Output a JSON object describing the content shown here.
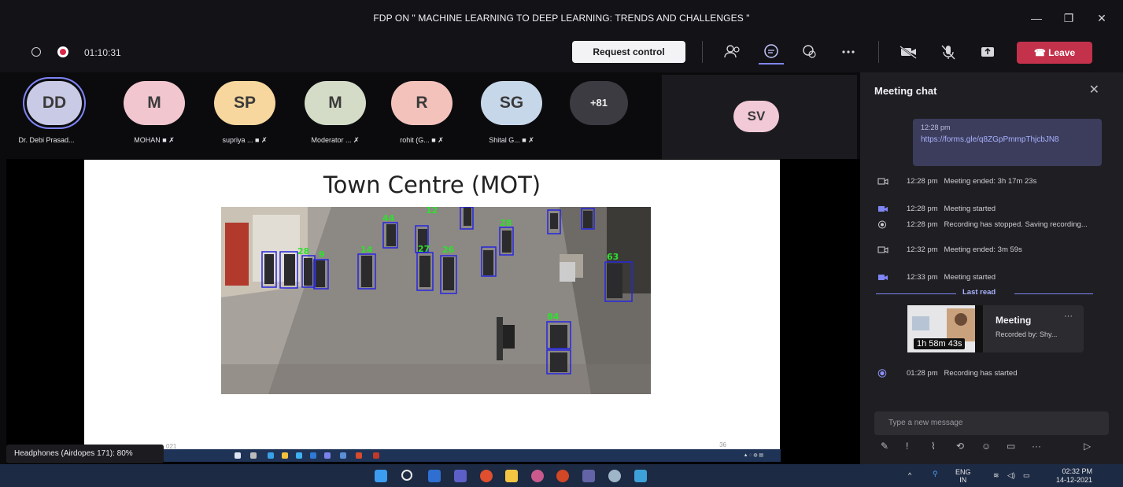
{
  "window": {
    "title": "FDP ON \" MACHINE LEARNING TO DEEP LEARNING: TRENDS AND CHALLENGES \""
  },
  "toolbar": {
    "timer": "01:10:31",
    "request_control": "Request control",
    "leave": "Leave"
  },
  "participants": [
    {
      "initials": "DD",
      "name": "Dr. Debi Prasad...",
      "color": "#c9cbe6"
    },
    {
      "initials": "M",
      "name": "MOHAN",
      "color": "#f1c6cf"
    },
    {
      "initials": "SP",
      "name": "supriya ...",
      "color": "#f7d79d"
    },
    {
      "initials": "M",
      "name": "Moderator ...",
      "color": "#d4dcc7"
    },
    {
      "initials": "R",
      "name": "rohit (G...",
      "color": "#f3c2bb"
    },
    {
      "initials": "SG",
      "name": "Shital G...",
      "color": "#c7d7ea"
    }
  ],
  "overflow_count": "+81",
  "spotlight": {
    "initials": "SV",
    "color": "#f2c9d6"
  },
  "slide": {
    "title": "Town Centre (MOT)",
    "footer_left": "021",
    "footer_right": "36",
    "track_labels": [
      "44",
      "12",
      "28",
      "9",
      "14",
      "27",
      "26",
      "28",
      "63",
      "84"
    ]
  },
  "toast": "Headphones (Airdopes 171): 80%",
  "chat": {
    "title": "Meeting chat",
    "message": {
      "time": "12:28 pm",
      "link": "https://forms.gle/q8ZGpPmmpThjcbJN8"
    },
    "events": [
      {
        "time": "12:28 pm",
        "text": "Meeting ended: 3h 17m 23s",
        "icon": "camera-outline-icon"
      },
      {
        "time": "12:28 pm",
        "text": "Meeting started",
        "icon": "camera-filled-icon"
      },
      {
        "time": "12:28 pm",
        "text": "Recording has stopped. Saving recording...",
        "icon": "record-icon"
      },
      {
        "time": "12:32 pm",
        "text": "Meeting ended: 3m 59s",
        "icon": "camera-outline-icon"
      },
      {
        "time": "12:33 pm",
        "text": "Meeting started",
        "icon": "camera-filled-icon"
      }
    ],
    "last_read": "Last read",
    "recording": {
      "duration": "1h 58m 43s",
      "title": "Meeting",
      "subtitle": "Recorded by: Shy..."
    },
    "last_event": {
      "time": "01:28 pm",
      "text": "Recording has started"
    },
    "input_placeholder": "Type a new message"
  },
  "system_tray": {
    "lang_top": "ENG",
    "lang_bottom": "IN",
    "time": "02:32 PM",
    "date": "14-12-2021"
  }
}
